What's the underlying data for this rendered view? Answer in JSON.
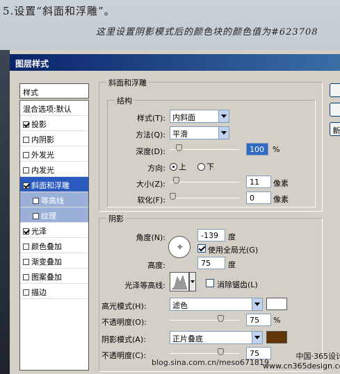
{
  "banner": {
    "step": "5.设置“斜面和浮雕”。",
    "note": "这里设置阴影模式后的颜色块的颜色值为#623708"
  },
  "dialog": {
    "title": "图层样式"
  },
  "styles_panel": {
    "header": "样式",
    "items": [
      {
        "label": "混合选项:默认",
        "checkbox": false,
        "checked": false
      },
      {
        "label": "投影",
        "checkbox": true,
        "checked": true
      },
      {
        "label": "内阴影",
        "checkbox": true,
        "checked": false
      },
      {
        "label": "外发光",
        "checkbox": true,
        "checked": false
      },
      {
        "label": "内发光",
        "checkbox": true,
        "checked": false
      },
      {
        "label": "斜面和浮雕",
        "checkbox": true,
        "checked": true
      },
      {
        "label": "等高线",
        "checkbox": true,
        "checked": false
      },
      {
        "label": "纹理",
        "checkbox": true,
        "checked": false
      },
      {
        "label": "光泽",
        "checkbox": true,
        "checked": true
      },
      {
        "label": "颜色叠加",
        "checkbox": true,
        "checked": false
      },
      {
        "label": "渐变叠加",
        "checkbox": true,
        "checked": false
      },
      {
        "label": "图案叠加",
        "checkbox": true,
        "checked": false
      },
      {
        "label": "描边",
        "checkbox": true,
        "checked": false
      }
    ]
  },
  "bevel": {
    "group_title": "斜面和浮雕",
    "structure_title": "结构",
    "style_label": "样式(T):",
    "style_value": "内斜面",
    "technique_label": "方法(Q):",
    "technique_value": "平滑",
    "depth_label": "深度(D):",
    "depth_value": "100",
    "depth_unit": "%",
    "depth_slider": 0.1,
    "direction_label": "方向:",
    "direction_up": "上",
    "direction_down": "下",
    "direction_selected": "up",
    "size_label": "大小(Z):",
    "size_value": "11",
    "size_unit": "像素",
    "size_slider": 0.05,
    "soften_label": "软化(F):",
    "soften_value": "0",
    "soften_unit": "像素",
    "soften_slider": 0.0
  },
  "shading": {
    "title": "阴影",
    "angle_label": "角度(N):",
    "angle_value": "-139",
    "angle_unit": "度",
    "global_light_label": "使用全局光(G)",
    "global_light_checked": true,
    "altitude_label": "高度:",
    "altitude_value": "75",
    "altitude_unit": "度",
    "gloss_label": "光泽等高线:",
    "antialias_label": "消除锯齿(L)",
    "antialias_checked": false,
    "highlight_label": "高光模式(H):",
    "highlight_value": "滤色",
    "highlight_color": "#ffffff",
    "highlight_opacity_label": "不透明度(O):",
    "highlight_opacity_value": "75",
    "highlight_opacity_unit": "%",
    "highlight_opacity_slider": 0.75,
    "shadow_label": "阴影模式(A):",
    "shadow_value": "正片叠底",
    "shadow_color": "#623708",
    "shadow_opacity_label": "不透明度(C):",
    "shadow_opacity_value": "75",
    "shadow_opacity_slider": 0.75
  },
  "buttons": {
    "new_label": "新"
  },
  "watermarks": {
    "blog": "blog.sina.com.cn/meso671819",
    "site_name": "中国·365设计网",
    "site_url": "www.cn365design.com"
  }
}
